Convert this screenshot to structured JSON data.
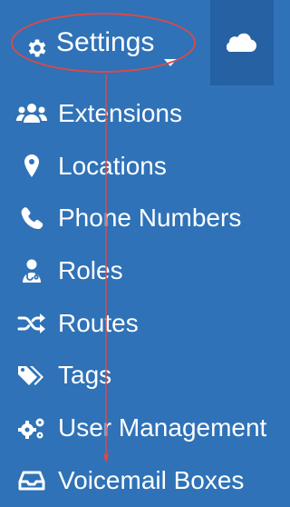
{
  "header": {
    "settings_label": "Settings",
    "settings_icon": "gear-icon",
    "settings_caret_icon": "caret-down-icon",
    "cloud_icon": "cloud-icon"
  },
  "menu": {
    "items": [
      {
        "label": "Extensions",
        "icon": "users-icon"
      },
      {
        "label": "Locations",
        "icon": "map-marker-icon"
      },
      {
        "label": "Phone Numbers",
        "icon": "phone-icon"
      },
      {
        "label": "Roles",
        "icon": "user-doctor-icon"
      },
      {
        "label": "Routes",
        "icon": "random-icon"
      },
      {
        "label": "Tags",
        "icon": "tags-icon"
      },
      {
        "label": "User Management",
        "icon": "cogs-icon"
      },
      {
        "label": "Voicemail Boxes",
        "icon": "inbox-icon"
      }
    ]
  },
  "annotation": {
    "highlight_color": "#d84a4a",
    "arrow_color": "#d84a4a"
  },
  "colors": {
    "background": "#2f72b7",
    "cloud_panel": "#2561a3",
    "text": "#ffffff"
  }
}
